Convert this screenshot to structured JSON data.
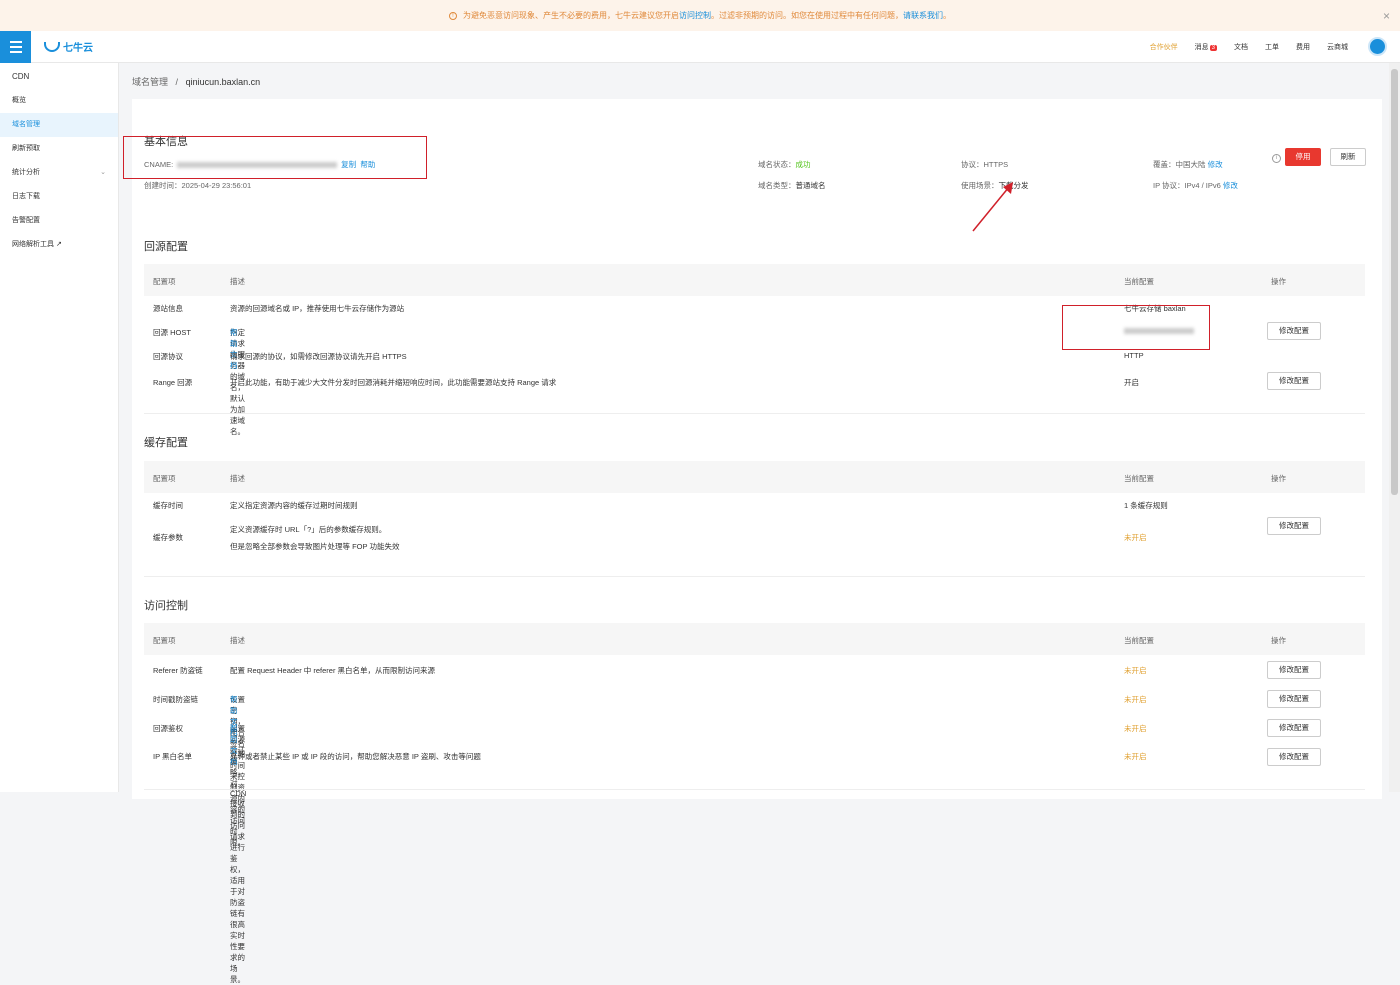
{
  "banner": {
    "text_a": "为避免恶意访问现象、产生不必要的费用，七牛云建议您开启",
    "link_a": "访问控制",
    "text_b": "。过滤非预期的访问。如您在使用过程中有任何问题，",
    "link_b": "请联系我们",
    "text_c": "。",
    "close": "×"
  },
  "topbar": {
    "logo": "七牛云",
    "links": [
      "合作伙伴",
      "消息",
      "文档",
      "工单",
      "费用",
      "云商城"
    ],
    "msg_badge": "3"
  },
  "sidebar": {
    "title": "CDN",
    "items": [
      "概览",
      "域名管理",
      "刷新预取",
      "统计分析",
      "日志下载",
      "告警配置",
      "网络解析工具"
    ],
    "chevron": "⌄",
    "external": "↗"
  },
  "breadcrumb": {
    "parent": "域名管理",
    "sep": "/",
    "current": "qiniucun.baxlan.cn"
  },
  "basic": {
    "title": "基本信息",
    "cname_label": "CNAME:",
    "copy": "复制",
    "help": "帮助",
    "created": "创建时间：2025-04-29 23:56:01",
    "status_label": "域名状态：",
    "status_value": "成功",
    "type_label": "域名类型：",
    "type_value": "普通域名",
    "protocol": "协议：HTTPS",
    "scene_label": "使用场景：",
    "scene_value": "下载分发",
    "coverage_label": "覆盖：中国大陆",
    "coverage_edit": "修改",
    "ip_label": "IP 协议：IPv4 / IPv6",
    "ip_edit": "修改",
    "stop_btn": "停用",
    "refresh_btn": "刷新"
  },
  "headers": {
    "item": "配置项",
    "desc": "描述",
    "current": "当前配置",
    "op": "操作"
  },
  "cfg_btn": "修改配置",
  "origin": {
    "title": "回源配置",
    "rows": [
      {
        "item": "源站信息",
        "desc": "资源的回源域名或 IP，推荐使用七牛云存储作为源站",
        "cur": "七牛云存储 baxlan"
      },
      {
        "item": "回源 HOST",
        "desc": "指定请求的服务器的域名，默认为加速域名。",
        "link": "帮助文档",
        "cur": ""
      },
      {
        "item": "回源协议",
        "desc": "请求回源的协议，如需修改回源协议请先开启 HTTPS",
        "cur": "HTTP"
      },
      {
        "item": "Range 回源",
        "desc": "开启此功能，有助于减少大文件分发时回源消耗并缩短响应时间，此功能需要源站支持 Range 请求",
        "cur": "开启"
      }
    ]
  },
  "cache": {
    "title": "缓存配置",
    "rows": [
      {
        "item": "缓存时间",
        "desc": "定义指定资源内容的缓存过期时间规则",
        "cur": "1 条缓存规则"
      },
      {
        "item": "缓存参数",
        "desc": "定义资源缓存时 URL「?」后的参数缓存规则。",
        "desc2": "但是忽略全部参数会导致图片处理等 FOP 功能失效",
        "cur": "未开启"
      }
    ]
  },
  "access": {
    "title": "访问控制",
    "rows": [
      {
        "item": "Referer 防盗链",
        "desc": "配置 Request Header 中 referer 黑白名单，从而限制访问来源",
        "cur": "未开启"
      },
      {
        "item": "时间戳防盗链",
        "desc": "设置密钥，配合签名过期时间来控制资源内容的访问时限。",
        "link": "帮助文档",
        "cur": "未开启"
      },
      {
        "item": "回源鉴权",
        "desc": "配置回源验证策略，对 CDN 接收到的访问请求进行鉴权，适用于对防盗链有很高实时性要求的场景。",
        "link": "帮助文档",
        "cur": "未开启"
      },
      {
        "item": "IP 黑白名单",
        "desc": "允许或者禁止某些 IP 或 IP 段的访问，帮助您解决恶意 IP 盗刷、攻击等问题",
        "cur": "未开启"
      }
    ]
  }
}
